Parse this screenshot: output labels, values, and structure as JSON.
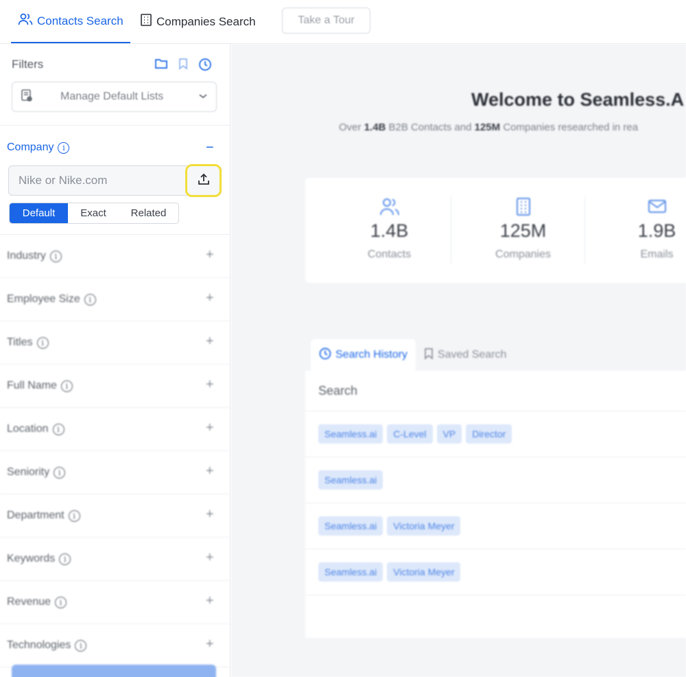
{
  "topbar": {
    "tabs": [
      {
        "label": "Contacts Search",
        "icon": "users-icon",
        "active": true
      },
      {
        "label": "Companies Search",
        "icon": "building-icon",
        "active": false
      }
    ],
    "tour_label": "Take a Tour"
  },
  "sidebar": {
    "filters_title": "Filters",
    "filters_icons": [
      "folder-icon",
      "bookmark-icon",
      "clock-icon"
    ],
    "manage_lists_label": "Manage Default Lists",
    "company": {
      "title": "Company",
      "placeholder": "Nike or Nike.com",
      "modes": [
        "Default",
        "Exact",
        "Related"
      ],
      "selected_mode": "Default"
    },
    "filters": [
      {
        "label": "Industry"
      },
      {
        "label": "Employee Size"
      },
      {
        "label": "Titles"
      },
      {
        "label": "Full Name"
      },
      {
        "label": "Location"
      },
      {
        "label": "Seniority"
      },
      {
        "label": "Department"
      },
      {
        "label": "Keywords"
      },
      {
        "label": "Revenue"
      },
      {
        "label": "Technologies"
      }
    ]
  },
  "main": {
    "welcome": "Welcome to Seamless.A",
    "subtitle_prefix": "Over ",
    "subtitle_contacts": "1.4B",
    "subtitle_mid": " B2B Contacts and ",
    "subtitle_companies": "125M",
    "subtitle_suffix": " Companies researched in rea",
    "stats": [
      {
        "value": "1.4B",
        "label": "Contacts",
        "icon": "users-icon"
      },
      {
        "value": "125M",
        "label": "Companies",
        "icon": "building-icon"
      },
      {
        "value": "1.9B",
        "label": "Emails",
        "icon": "mail-icon"
      }
    ],
    "tabs": [
      {
        "label": "Search History",
        "icon": "clock-icon",
        "active": true
      },
      {
        "label": "Saved Search",
        "icon": "bookmark-icon",
        "active": false
      }
    ],
    "history_header": "Search",
    "history_rows": [
      [
        "Seamless.ai",
        "C-Level",
        "VP",
        "Director"
      ],
      [
        "Seamless.ai"
      ],
      [
        "Seamless.ai",
        "Victoria Meyer"
      ],
      [
        "Seamless.ai",
        "Victoria Meyer"
      ]
    ]
  },
  "colors": {
    "accent": "#1a66e6",
    "highlight": "#f2de3a",
    "chip_bg": "#dde8fb"
  }
}
